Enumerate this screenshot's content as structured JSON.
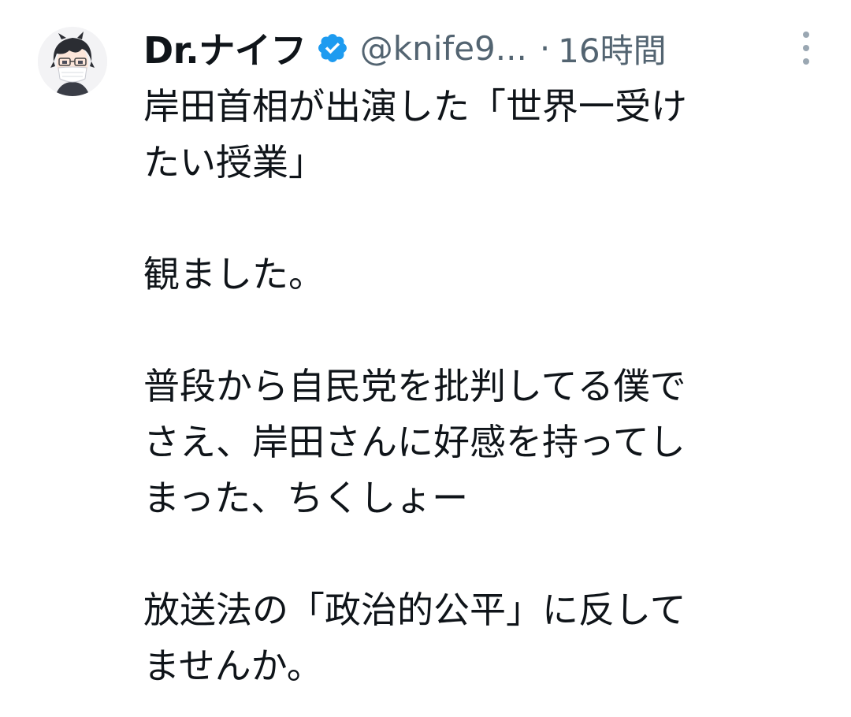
{
  "tweet": {
    "display_name": "Dr.ナイフ",
    "handle": "@knife9...",
    "separator": "·",
    "time": "16時間",
    "verified_icon": "verified-badge-icon",
    "more_icon": "more-options-icon",
    "avatar": "user-avatar",
    "lines": [
      "岸田首相が出演した「世界一受け",
      "たい授業」",
      "",
      "観ました。",
      "",
      "普段から自民党を批判してる僕で",
      "さえ、岸田さんに好感を持ってし",
      "まった、ちくしょー",
      "",
      "放送法の「政治的公平」に反して",
      "ませんか。"
    ]
  },
  "colors": {
    "text": "#0f1419",
    "secondary": "#536471",
    "verified": "#1d9bf0"
  }
}
